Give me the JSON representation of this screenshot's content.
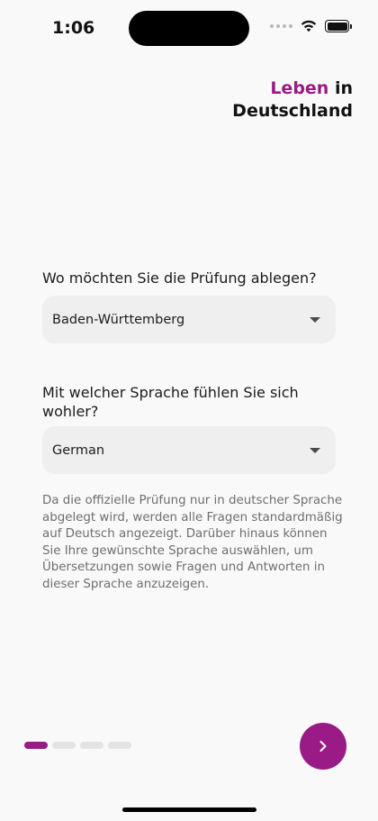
{
  "status_bar": {
    "time": "1:06"
  },
  "brand": {
    "accent_word": "Leben",
    "line1_rest": " in",
    "line2": "Deutschland"
  },
  "location": {
    "question": "Wo möchten Sie die Prüfung ablegen?",
    "selected": "Baden-Württemberg"
  },
  "language": {
    "question": "Mit welcher Sprache fühlen Sie sich wohler?",
    "selected": "German"
  },
  "info_text": "Da die offizielle Prüfung nur in deutscher Sprache abgelegt wird, werden alle Fragen standardmäßig auf Deutsch angezeigt. Darüber hinaus können Sie Ihre gewünschte Sprache auswählen, um Übersetzungen sowie Fragen und Antworten in dieser Sprache anzuzeigen.",
  "pager": {
    "total": 4,
    "current": 1
  },
  "next_button": {
    "icon": "chevron-right-icon"
  },
  "colors": {
    "accent": "#9b1b86",
    "background": "#f9f9f9",
    "field": "#efefef"
  }
}
